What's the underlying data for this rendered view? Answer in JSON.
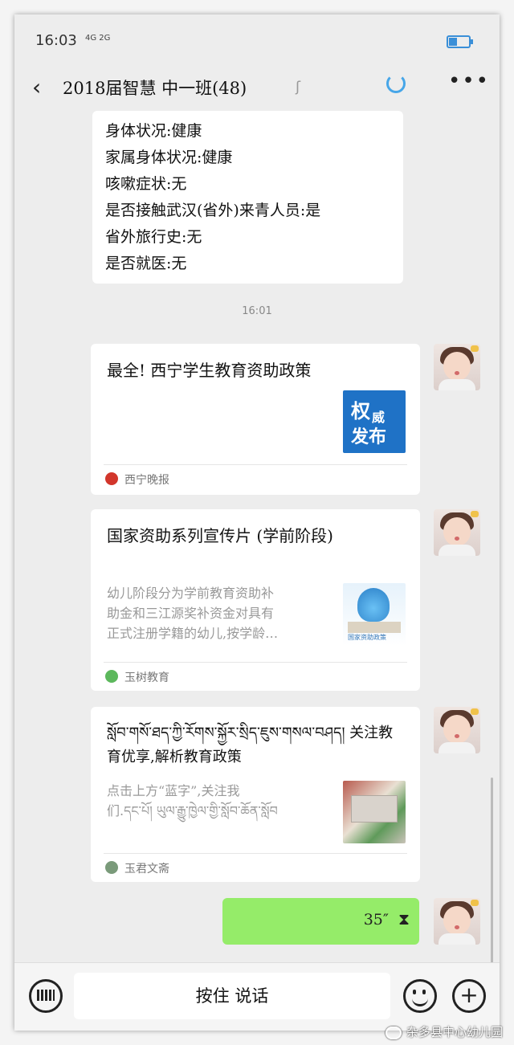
{
  "status_bar": {
    "time": "16:03",
    "network": "4G 2G"
  },
  "header": {
    "title": "2018届智慧 中一班(48)",
    "back_icon": "chevron-left-icon",
    "more_icon": "ellipsis-icon",
    "ear_icon": "earpiece-icon"
  },
  "top_message": {
    "lines": [
      "身体状况:健康",
      "家属身体状况:健康",
      "咳嗽症状:无",
      "是否接触武汉(省外)来青人员:是",
      "省外旅行史:无",
      "是否就医:无"
    ]
  },
  "timestamp": "16:01",
  "cards": [
    {
      "title": "最全! 西宁学生教育资助政策",
      "thumb_text": [
        "权",
        "威",
        "发布"
      ],
      "source": "西宁晚报"
    },
    {
      "title": "国家资助系列宣传片 (学前阶段)",
      "desc": [
        "幼儿阶段分为学前教育资助补",
        "助金和三江源奖补资金对具有",
        "正式注册学籍的幼儿,按学龄…"
      ],
      "thumb_caption": "国家资助政策",
      "source": "玉树教育"
    },
    {
      "title": "སློབ་གསོ་ཐད་ཀྱི་རོགས་སྐྱོར་སྲིད་ཇུས་གསལ་བཤད། 关注教育优享,解析教育政策",
      "desc": [
        "点击上方“蓝字”,关注我",
        "们.དང་པོ། ཡུལ་རྒྱུ་ཁྱེལ་གྱི་སློབ་ཆོན་སློབ"
      ],
      "source": "玉君文斋"
    }
  ],
  "voice_message": {
    "duration": "35″"
  },
  "bottom_bar": {
    "hold_to_talk": "按住 说话"
  },
  "watermark": "杂多县中心幼儿园",
  "colors": {
    "voice_bubble": "#95ec69",
    "thumb_blue": "#1f72c6",
    "loading": "#47a6e8"
  }
}
